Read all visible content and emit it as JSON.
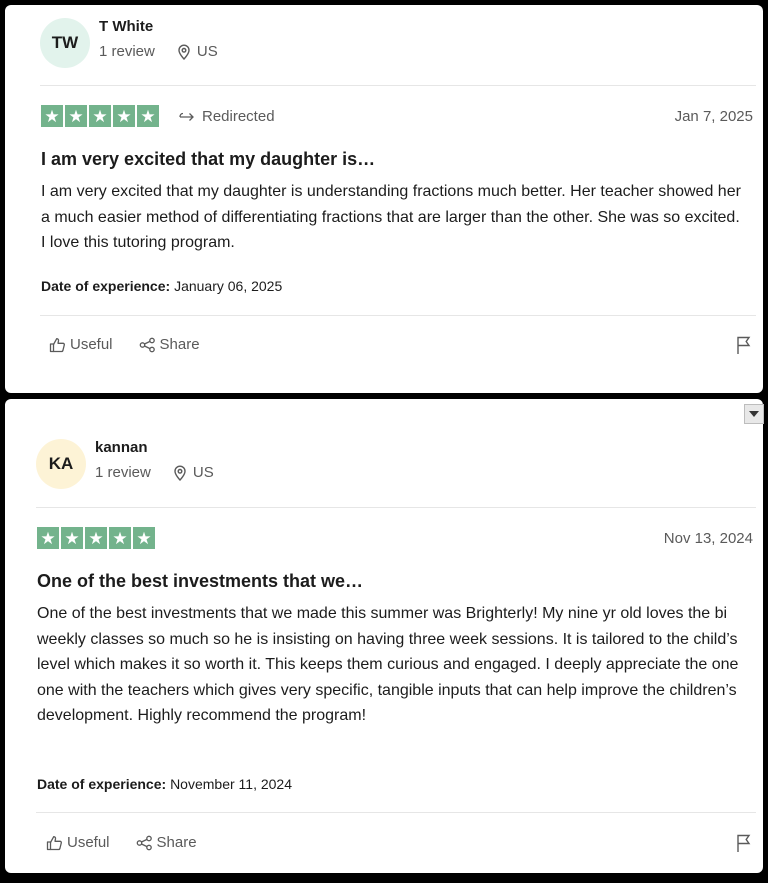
{
  "reviews": [
    {
      "avatar": {
        "initials": "TW",
        "bg": "#e2f3ec"
      },
      "name": "T White",
      "review_count": "1 review",
      "country": "US",
      "rating": 5,
      "star_color": "#73b38c",
      "redirected_label": "Redirected",
      "date": "Jan 7, 2025",
      "title": "I am very excited that my daughter is…",
      "body": "I am very excited that my daughter is understanding fractions much better. Her teacher showed her a much easier method of differentiating fractions that are larger than the other. She was so excited. I love this tutoring program.",
      "experience_label": "Date of experience:",
      "experience_date": "January 06, 2025",
      "useful_label": "Useful",
      "share_label": "Share"
    },
    {
      "avatar": {
        "initials": "KA",
        "bg": "#fdf3d6"
      },
      "name": "kannan",
      "review_count": "1 review",
      "country": "US",
      "rating": 5,
      "star_color": "#73b38c",
      "date": "Nov 13, 2024",
      "title": "One of the best investments that we…",
      "body": "One of the best investments that we made this summer was Brighterly! My nine yr old loves the bi weekly classes so much so he is insisting on having three week sessions. It is tailored to the child’s level which makes it so worth it. This keeps them curious and engaged. I deeply appreciate the one one with the teachers which gives very specific, tangible inputs that can help improve the children’s development. Highly recommend the program!",
      "experience_label": "Date of experience:",
      "experience_date": "November 11, 2024",
      "useful_label": "Useful",
      "share_label": "Share"
    }
  ]
}
